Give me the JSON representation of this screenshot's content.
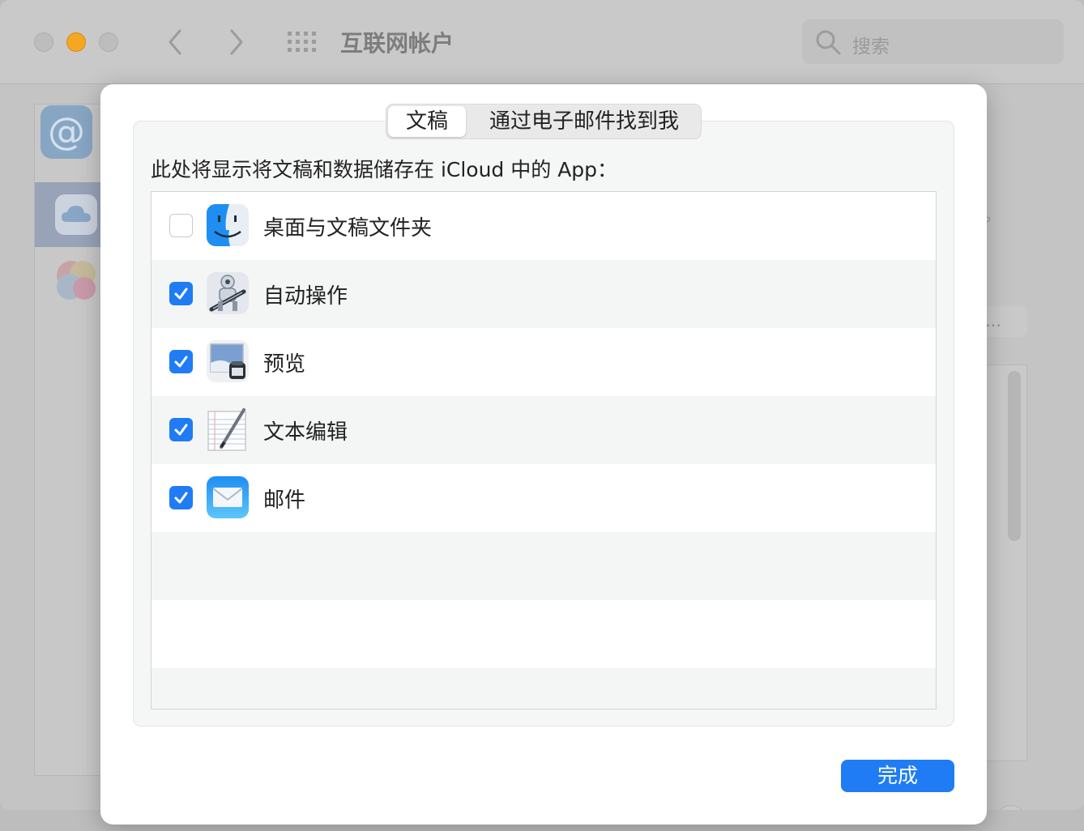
{
  "window": {
    "title": "互联网帐户",
    "search_placeholder": "搜索",
    "right_button_label": "…",
    "help_label": "?"
  },
  "dialog": {
    "tabs": [
      {
        "label": "文稿",
        "active": true
      },
      {
        "label": "通过电子邮件找到我",
        "active": false
      }
    ],
    "description": "此处将显示将文稿和数据储存在 iCloud 中的 App：",
    "apps": [
      {
        "name": "桌面与文稿文件夹",
        "checked": false,
        "icon": "finder-icon"
      },
      {
        "name": "自动操作",
        "checked": true,
        "icon": "automator-icon"
      },
      {
        "name": "预览",
        "checked": true,
        "icon": "preview-icon"
      },
      {
        "name": "文本编辑",
        "checked": true,
        "icon": "textedit-icon"
      },
      {
        "name": "邮件",
        "checked": true,
        "icon": "mail-icon"
      }
    ],
    "done_label": "完成"
  },
  "colors": {
    "accent": "#1f7cf4",
    "minimize": "#f5a623"
  }
}
